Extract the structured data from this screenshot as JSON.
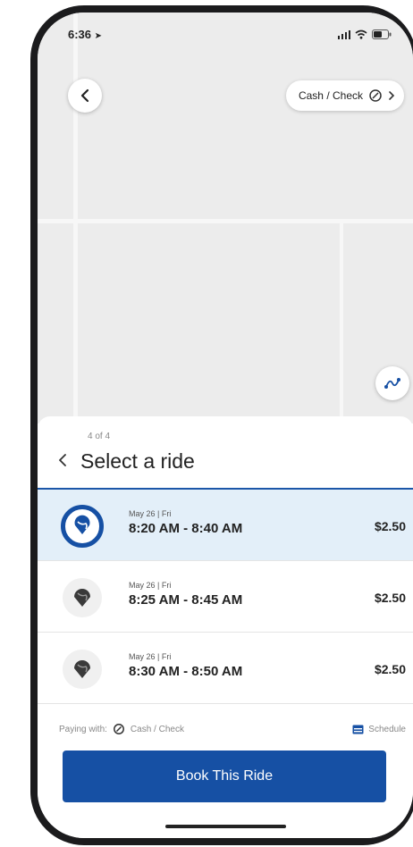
{
  "status": {
    "time": "6:36"
  },
  "map": {
    "payment_chip_label": "Cash / Check"
  },
  "sheet": {
    "step": "4 of 4",
    "title": "Select a ride"
  },
  "rides": [
    {
      "date": "May 26 | Fri",
      "time_range": "8:20 AM - 8:40 AM",
      "price": "$2.50",
      "selected": true
    },
    {
      "date": "May 26 | Fri",
      "time_range": "8:25 AM - 8:45 AM",
      "price": "$2.50",
      "selected": false
    },
    {
      "date": "May 26 | Fri",
      "time_range": "8:30 AM - 8:50 AM",
      "price": "$2.50",
      "selected": false
    }
  ],
  "payment": {
    "paying_with_label": "Paying with:",
    "method": "Cash / Check",
    "schedule_label": "Schedule"
  },
  "actions": {
    "book_label": "Book This Ride"
  },
  "colors": {
    "accent": "#1650a4",
    "selected_row": "#e3eff9",
    "marker_dark": "#3a3a3a"
  }
}
